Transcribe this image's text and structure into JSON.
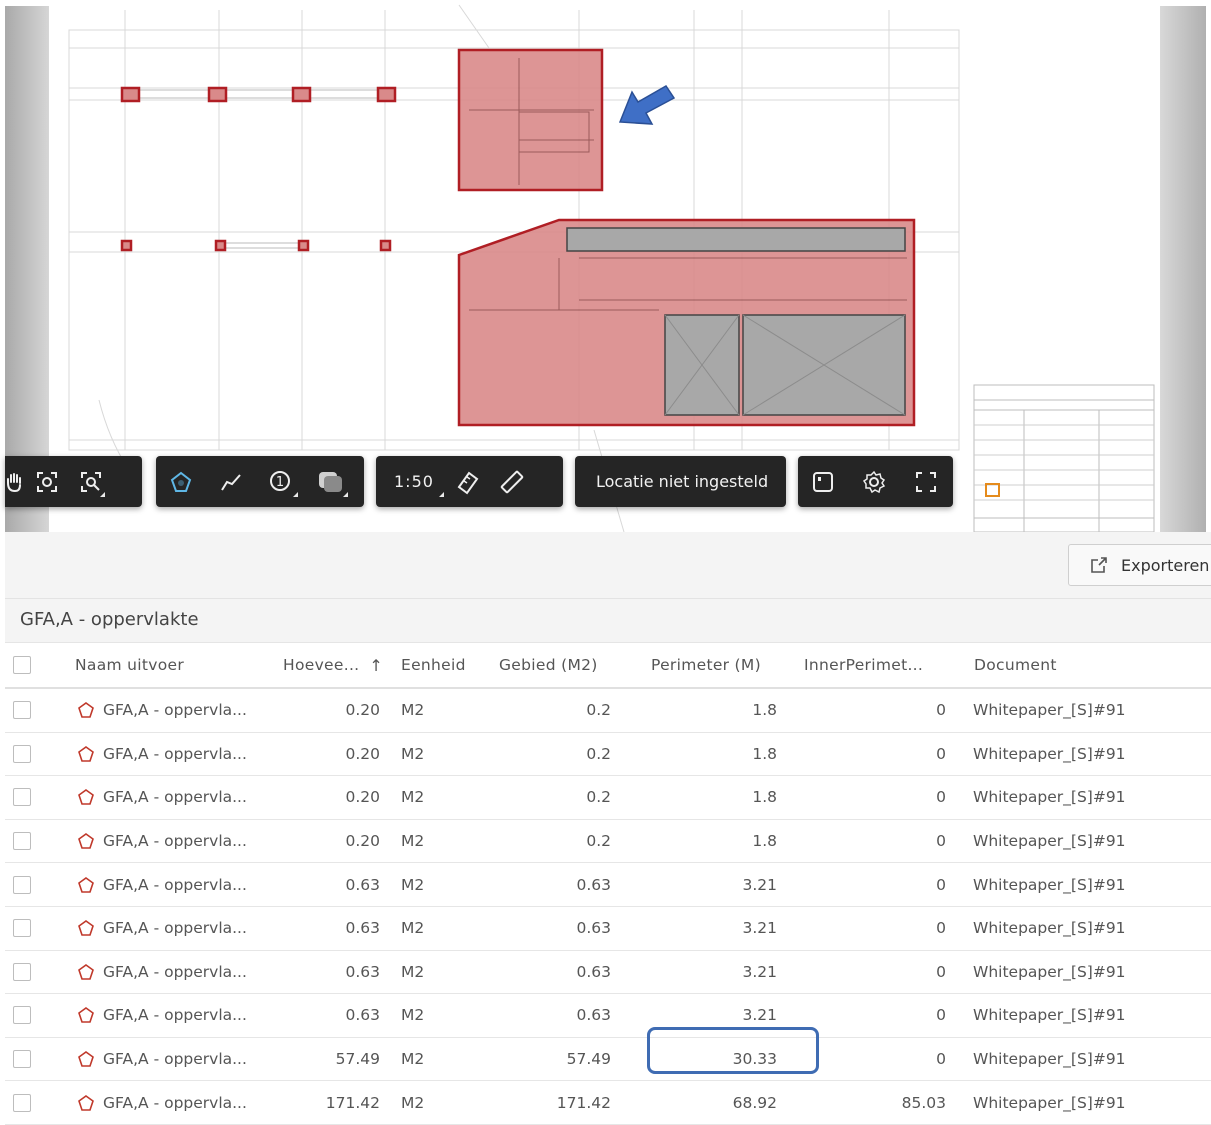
{
  "toolbar": {
    "scale_label": "1:50",
    "location_label": "Locatie niet ingesteld",
    "icons": [
      "pan-hand-icon",
      "zoom-fit-icon",
      "zoom-window-icon",
      "polygon-area-icon",
      "polyline-icon",
      "count-marker-icon",
      "color-fill-icon",
      "ruler-set-icon",
      "ruler-icon",
      "panel-icon",
      "settings-icon",
      "fullscreen-icon"
    ]
  },
  "export": {
    "label": "Exporteren"
  },
  "group": {
    "title": "GFA,A - oppervlakte"
  },
  "table": {
    "columns": {
      "name": "Naam uitvoer",
      "quantity": "Hoevee...",
      "unit": "Eenheid",
      "area": "Gebied (M2)",
      "perimeter": "Perimeter (M)",
      "inner_perimeter": "InnerPerimet...",
      "document": "Document"
    },
    "sort_indicator": "↑",
    "rows": [
      {
        "name": "GFA,A - oppervla...",
        "quantity": "0.20",
        "unit": "M2",
        "area": "0.2",
        "perimeter": "1.8",
        "inner_perimeter": "0",
        "document": "Whitepaper_[S]#91"
      },
      {
        "name": "GFA,A - oppervla...",
        "quantity": "0.20",
        "unit": "M2",
        "area": "0.2",
        "perimeter": "1.8",
        "inner_perimeter": "0",
        "document": "Whitepaper_[S]#91"
      },
      {
        "name": "GFA,A - oppervla...",
        "quantity": "0.20",
        "unit": "M2",
        "area": "0.2",
        "perimeter": "1.8",
        "inner_perimeter": "0",
        "document": "Whitepaper_[S]#91"
      },
      {
        "name": "GFA,A - oppervla...",
        "quantity": "0.20",
        "unit": "M2",
        "area": "0.2",
        "perimeter": "1.8",
        "inner_perimeter": "0",
        "document": "Whitepaper_[S]#91"
      },
      {
        "name": "GFA,A - oppervla...",
        "quantity": "0.63",
        "unit": "M2",
        "area": "0.63",
        "perimeter": "3.21",
        "inner_perimeter": "0",
        "document": "Whitepaper_[S]#91"
      },
      {
        "name": "GFA,A - oppervla...",
        "quantity": "0.63",
        "unit": "M2",
        "area": "0.63",
        "perimeter": "3.21",
        "inner_perimeter": "0",
        "document": "Whitepaper_[S]#91"
      },
      {
        "name": "GFA,A - oppervla...",
        "quantity": "0.63",
        "unit": "M2",
        "area": "0.63",
        "perimeter": "3.21",
        "inner_perimeter": "0",
        "document": "Whitepaper_[S]#91"
      },
      {
        "name": "GFA,A - oppervla...",
        "quantity": "0.63",
        "unit": "M2",
        "area": "0.63",
        "perimeter": "3.21",
        "inner_perimeter": "0",
        "document": "Whitepaper_[S]#91"
      },
      {
        "name": "GFA,A - oppervla...",
        "quantity": "57.49",
        "unit": "M2",
        "area": "57.49",
        "perimeter": "30.33",
        "inner_perimeter": "0",
        "document": "Whitepaper_[S]#91"
      },
      {
        "name": "GFA,A - oppervla...",
        "quantity": "171.42",
        "unit": "M2",
        "area": "171.42",
        "perimeter": "68.92",
        "inner_perimeter": "85.03",
        "document": "Whitepaper_[S]#91"
      }
    ]
  },
  "colors": {
    "markup_fill": "#d98a8a",
    "markup_stroke": "#b01e24",
    "toolbar_bg": "#252525",
    "annotation_blue": "#3f6cb3",
    "polygon_icon": "#5fb7e6"
  }
}
